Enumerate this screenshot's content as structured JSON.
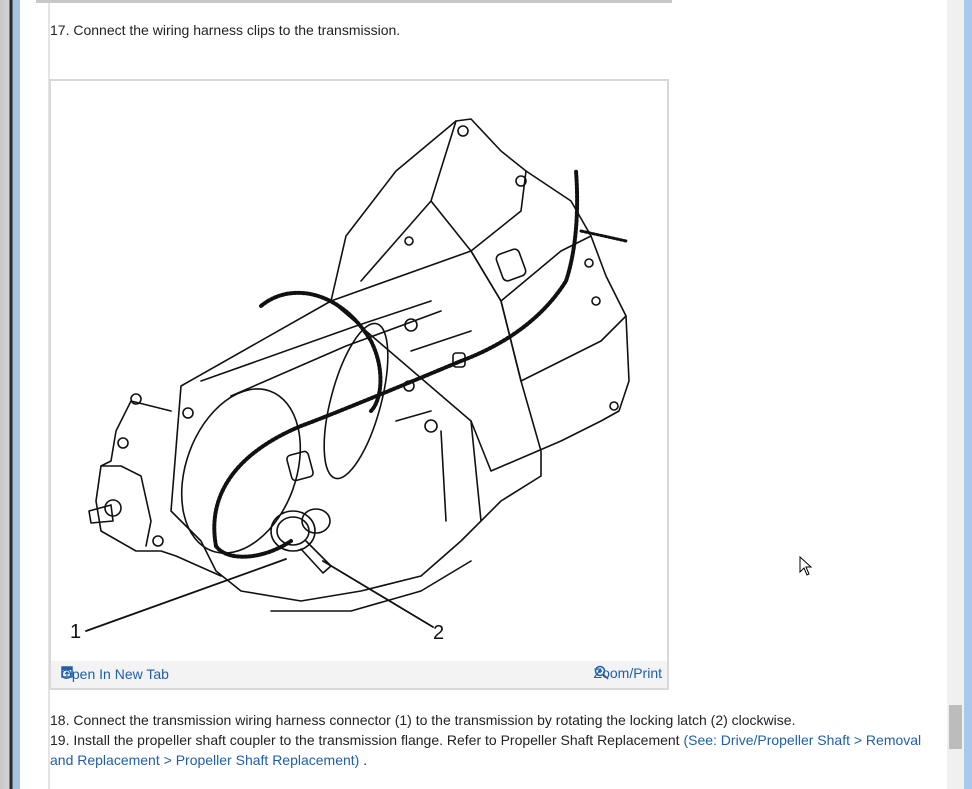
{
  "steps": {
    "s17": "17. Connect the wiring harness clips to the transmission.",
    "s18": "18. Connect the transmission wiring harness connector (1) to the transmission by rotating the locking latch (2) clockwise.",
    "s19_text": "19. Install the propeller shaft coupler to the transmission flange. Refer to Propeller Shaft Replacement ",
    "s19_link_line1": "(See: Drive/Propeller Shaft > Removal",
    "s19_link_line2": "and Replacement > Propeller Shaft Replacement)",
    "s19_end": " ."
  },
  "figure": {
    "callout_1": "1",
    "callout_2": "2",
    "open_new_tab": "Open In New Tab",
    "zoom_print": "Zoom/Print",
    "open_icon": "open-new-tab-icon",
    "zoom_icon": "magnifier-plus-icon"
  },
  "colors": {
    "link": "#1f5fa8",
    "text": "#222222"
  }
}
